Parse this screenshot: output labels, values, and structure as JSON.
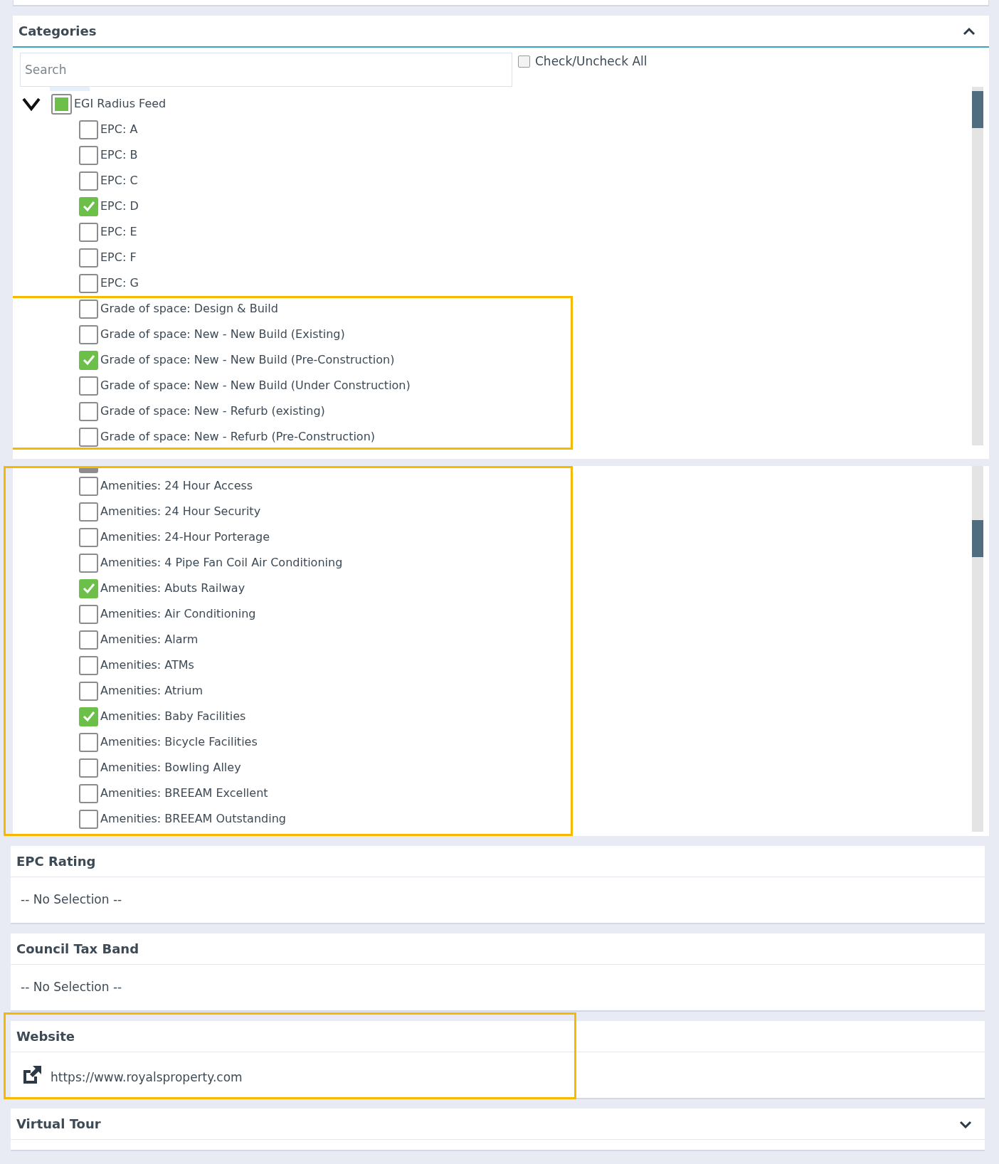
{
  "categories": {
    "title": "Categories",
    "expanded": true,
    "search": {
      "placeholder": "Search"
    },
    "check_all": {
      "label": "Check/Uncheck All",
      "checked": false
    },
    "tree_view_top": {
      "root": {
        "label": "EGI Radius Feed",
        "expanded": true,
        "indeterminate": true
      },
      "groups": [
        {
          "highlighted": false,
          "items": [
            {
              "label": "EPC: A",
              "checked": false
            },
            {
              "label": "EPC: B",
              "checked": false
            },
            {
              "label": "EPC: C",
              "checked": false
            },
            {
              "label": "EPC: D",
              "checked": true
            },
            {
              "label": "EPC: E",
              "checked": false
            },
            {
              "label": "EPC: F",
              "checked": false
            },
            {
              "label": "EPC: G",
              "checked": false
            }
          ]
        },
        {
          "highlighted": true,
          "items": [
            {
              "label": "Grade of space: Design & Build",
              "checked": false
            },
            {
              "label": "Grade of space: New - New Build (Existing)",
              "checked": false
            },
            {
              "label": "Grade of space: New - New Build (Pre-Construction)",
              "checked": true
            },
            {
              "label": "Grade of space: New - New Build (Under Construction)",
              "checked": false
            },
            {
              "label": "Grade of space: New - Refurb (existing)",
              "checked": false
            },
            {
              "label": "Grade of space: New - Refurb (Pre-Construction)",
              "checked": false
            }
          ]
        }
      ]
    },
    "tree_view_scrolled": {
      "highlighted": true,
      "items": [
        {
          "label": "Amenities: 24 Hour Access",
          "checked": false
        },
        {
          "label": "Amenities: 24 Hour Security",
          "checked": false
        },
        {
          "label": "Amenities: 24-Hour Porterage",
          "checked": false
        },
        {
          "label": "Amenities: 4 Pipe Fan Coil Air Conditioning",
          "checked": false
        },
        {
          "label": "Amenities: Abuts Railway",
          "checked": true
        },
        {
          "label": "Amenities: Air Conditioning",
          "checked": false
        },
        {
          "label": "Amenities: Alarm",
          "checked": false
        },
        {
          "label": "Amenities: ATMs",
          "checked": false
        },
        {
          "label": "Amenities: Atrium",
          "checked": false
        },
        {
          "label": "Amenities: Baby Facilities",
          "checked": true
        },
        {
          "label": "Amenities: Bicycle Facilities",
          "checked": false
        },
        {
          "label": "Amenities: Bowling Alley",
          "checked": false
        },
        {
          "label": "Amenities: BREEAM Excellent",
          "checked": false
        },
        {
          "label": "Amenities: BREEAM Outstanding",
          "checked": false
        }
      ]
    }
  },
  "sections": [
    {
      "title": "EPC Rating",
      "kind": "text",
      "value": "-- No Selection --",
      "highlighted": false
    },
    {
      "title": "Council Tax Band",
      "kind": "text",
      "value": "-- No Selection --",
      "highlighted": false
    },
    {
      "title": "Website",
      "kind": "link",
      "value": "https://www.royalsproperty.com",
      "highlighted": true
    },
    {
      "title": "Virtual Tour",
      "kind": "collapsed",
      "expanded": false,
      "highlighted": false
    }
  ]
}
